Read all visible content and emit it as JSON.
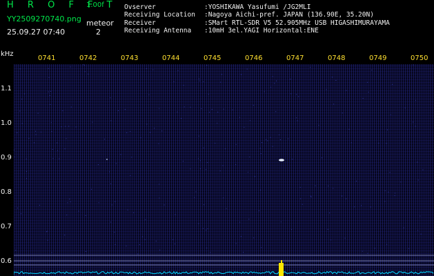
{
  "header": {
    "app_title": "H R O F F T",
    "version": "1.00f",
    "file_name": "YY2509270740.png",
    "date_time": "25.09.27 07:40",
    "meteor_label": "meteor",
    "meteor_count": "2"
  },
  "station_info": [
    {
      "key": "Ovserver",
      "value": ":YOSHIKAWA Yasufumi /JG2MLI"
    },
    {
      "key": "Receiving Location",
      "value": ":Nagoya Aichi-pref. JAPAN (136.90E, 35.20N)"
    },
    {
      "key": "Receiver",
      "value": ":SMart RTL-SDR V5 52.905MHz USB HIGASHIMURAYAMA"
    },
    {
      "key": "Receiving Antenna",
      "value": ":10mH 3el.YAGI Horizontal:ENE"
    }
  ],
  "waterfall": {
    "freq_unit": "kHz",
    "time_ticks": [
      "0741",
      "0742",
      "0743",
      "0744",
      "0745",
      "0746",
      "0747",
      "0748",
      "0749",
      "0750"
    ],
    "freq_ticks": [
      "1.1",
      "1.0",
      "0.9",
      "0.8",
      "0.7",
      "0.6"
    ],
    "colors": {
      "text_green": "#00e64a",
      "text_white": "#f2f2f2",
      "tick_yellow": "#ffe030",
      "background": "#06061c",
      "spectrum_cyan": "#00d8ff",
      "meteor_peak": "#ffe600"
    }
  }
}
